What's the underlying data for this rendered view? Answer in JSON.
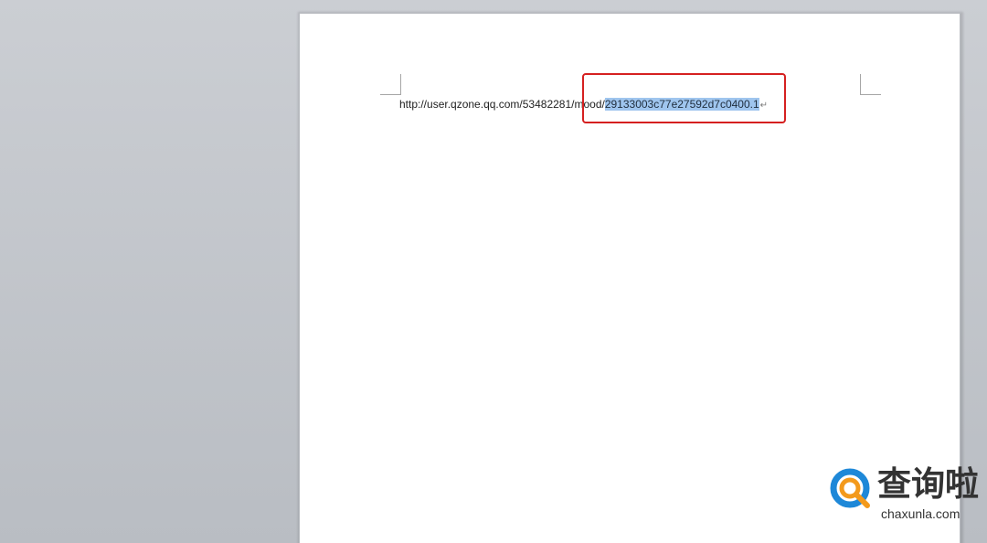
{
  "document": {
    "url_prefix": "http://user.qzone.qq.com/53482281/mood/",
    "url_selected": "29133003c77e27592d7c0400.1",
    "paragraph_mark": "↵"
  },
  "watermark": {
    "title": "查询啦",
    "site": "chaxunla.com",
    "logo_icon": "q-magnifier-logo-icon",
    "colors": {
      "blue": "#1e88d8",
      "orange": "#f39a1c"
    }
  },
  "colors": {
    "selection": "#9fc5ee",
    "annotation_box": "#d52020"
  }
}
